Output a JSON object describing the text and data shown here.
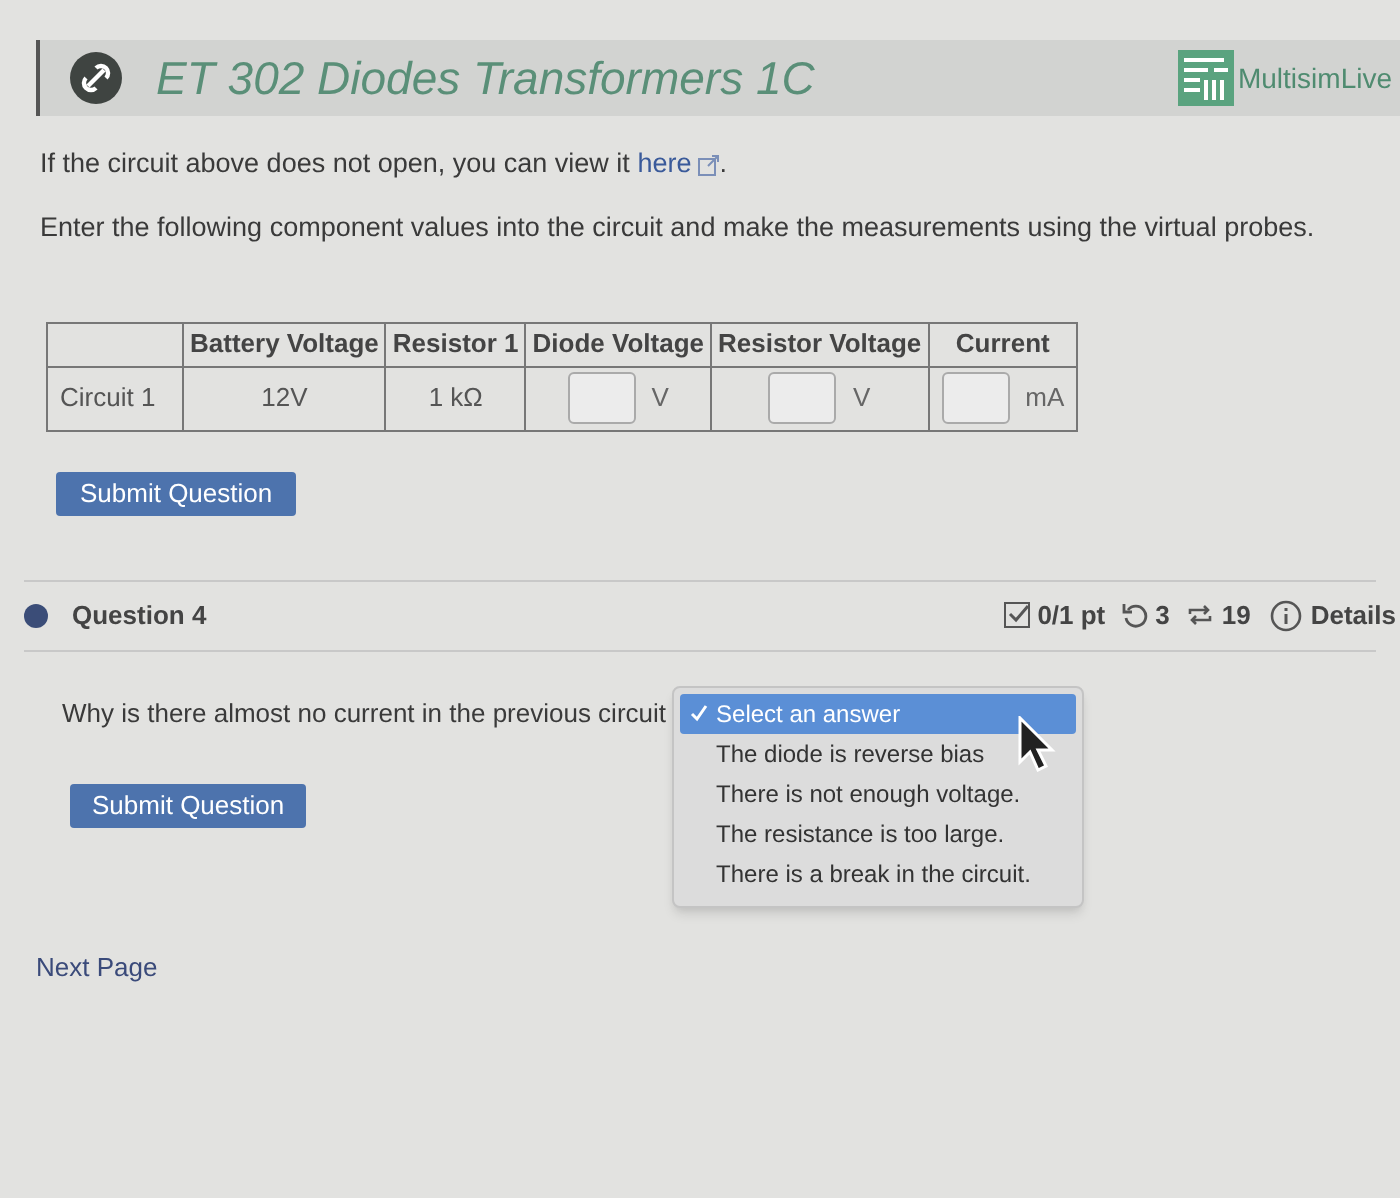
{
  "header": {
    "title": "ET 302 Diodes Transformers 1C",
    "brand": "MultisimLive"
  },
  "intro": {
    "text": "If the circuit above does not open, you can view it",
    "link": "here",
    "after": "."
  },
  "instructions": "Enter the following component values into the circuit and make the measurements using the virtual probes.",
  "table": {
    "columns": [
      "Battery Voltage",
      "Resistor 1",
      "Diode Voltage",
      "Resistor Voltage",
      "Current"
    ],
    "rows": [
      {
        "label": "Circuit 1",
        "cells": [
          {
            "kind": "value",
            "text": "12V"
          },
          {
            "kind": "value",
            "text": "1 kΩ"
          },
          {
            "kind": "input",
            "unit": "V"
          },
          {
            "kind": "input",
            "unit": "V"
          },
          {
            "kind": "input",
            "unit": "mA"
          }
        ]
      }
    ]
  },
  "submit_1": "Submit Question",
  "question": {
    "title": "Question 4",
    "points": "0/1 pt",
    "retries": "3",
    "attempts": "19",
    "details": "Details",
    "prompt": "Why is there almost no current in the previous circuit",
    "options": [
      {
        "label": "Select an answer",
        "selected": true
      },
      {
        "label": "The diode is reverse bias",
        "selected": false
      },
      {
        "label": "There is not enough voltage.",
        "selected": false
      },
      {
        "label": "The resistance is too large.",
        "selected": false
      },
      {
        "label": "There is a break in the circuit.",
        "selected": false
      }
    ]
  },
  "submit_2": "Submit Question",
  "next_page": "Next Page"
}
